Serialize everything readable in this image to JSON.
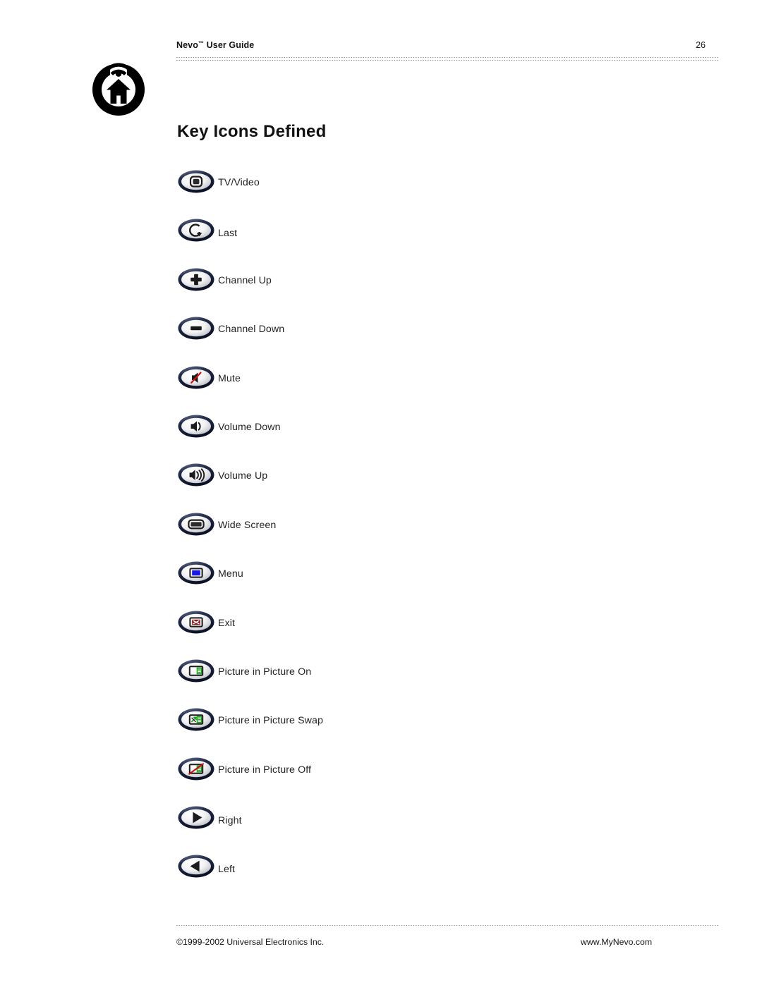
{
  "document": {
    "header": {
      "title": "Nevo™ User Guide",
      "title_base": "Nevo",
      "title_tm": "™",
      "title_rest": " User Guide",
      "page_number": "26"
    },
    "logo": {
      "name": "nevo-house-signal-logo",
      "color": "#000000"
    },
    "section_title": "Key Icons Defined",
    "footer": {
      "copyright": "©1999-2002 Universal Electronics Inc.",
      "website": "www.MyNevo.com"
    }
  },
  "colors": {
    "page_background": "#ffffff",
    "text": "#1a1a1a",
    "icon_ring_dark": "#141c33",
    "icon_ring_mid": "#2b3655",
    "icon_ring_light": "#6a748f",
    "icon_face_light": "#fdfdfd",
    "icon_face_shade": "#b8bcc4",
    "glyph_dark": "#1b1b1b",
    "accent_red": "#cc1111",
    "accent_blue": "#1717e8",
    "accent_green": "#15a015",
    "accent_darkred": "#8c1418",
    "rule_dots": "#8c8c8c"
  },
  "icons": [
    {
      "glyph": "tv-video-icon",
      "label": "TV/Video"
    },
    {
      "glyph": "last-icon",
      "label": "Last"
    },
    {
      "glyph": "channel-up-icon",
      "label": "Channel Up"
    },
    {
      "glyph": "channel-down-icon",
      "label": "Channel Down"
    },
    {
      "glyph": "mute-icon",
      "label": "Mute"
    },
    {
      "glyph": "volume-down-icon",
      "label": "Volume Down"
    },
    {
      "glyph": "volume-up-icon",
      "label": "Volume Up"
    },
    {
      "glyph": "wide-screen-icon",
      "label": "Wide Screen"
    },
    {
      "glyph": "menu-icon",
      "label": "Menu"
    },
    {
      "glyph": "exit-icon",
      "label": "Exit"
    },
    {
      "glyph": "picture-in-picture-on-icon",
      "label": "Picture in Picture On"
    },
    {
      "glyph": "picture-in-picture-swap-icon",
      "label": "Picture in Picture Swap"
    },
    {
      "glyph": "picture-in-picture-off-icon",
      "label": "Picture in Picture Off"
    },
    {
      "glyph": "right-icon",
      "label": "Right"
    },
    {
      "glyph": "left-icon",
      "label": "Left"
    }
  ]
}
